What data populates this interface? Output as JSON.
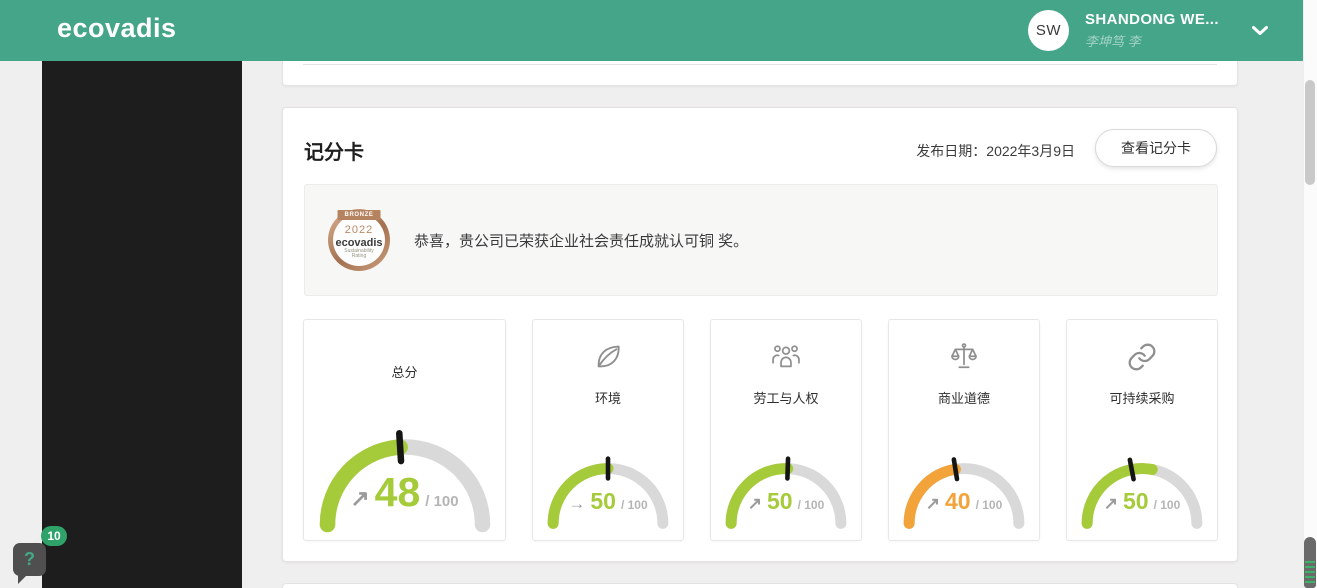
{
  "header": {
    "logo": "ecovadis",
    "user": {
      "initials": "SW",
      "name": "SHANDONG WE...",
      "subtitle": "李坤笃 李"
    }
  },
  "help": {
    "glyph": "?",
    "badge": "10"
  },
  "scorecard": {
    "title": "记分卡",
    "publish_date": "发布日期：2022年3月9日",
    "view_button": "查看记分卡",
    "award": {
      "medal": {
        "tier": "BRONZE",
        "year": "2022",
        "brand": "ecovadis",
        "tagline": "Sustainability Rating"
      },
      "message": "恭喜，贵公司已荣获企业社会责任成就认可铜 奖。"
    },
    "gauges": [
      {
        "label": "总分",
        "icon": null,
        "size": "large",
        "value": "48",
        "suffix": "/ 100",
        "trend_arrow": "↗",
        "color": "#a6cb3a",
        "fill_pct": 48,
        "needle_pct": 48
      },
      {
        "label": "环境",
        "icon": "leaf-icon",
        "size": "small",
        "value": "50",
        "suffix": "/ 100",
        "trend_arrow": "→",
        "color": "#a6cb3a",
        "fill_pct": 50,
        "needle_pct": 50
      },
      {
        "label": "劳工与人权",
        "icon": "people-icon",
        "size": "small",
        "value": "50",
        "suffix": "/ 100",
        "trend_arrow": "↗",
        "color": "#a6cb3a",
        "fill_pct": 51,
        "needle_pct": 51
      },
      {
        "label": "商业道德",
        "icon": "scales-icon",
        "size": "small",
        "value": "40",
        "suffix": "/ 100",
        "trend_arrow": "↗",
        "color": "#f2a33a",
        "fill_pct": 45,
        "needle_pct": 45
      },
      {
        "label": "可持续采购",
        "icon": "link-icon",
        "size": "small",
        "value": "50",
        "suffix": "/ 100",
        "trend_arrow": "↗",
        "color": "#a6cb3a",
        "fill_pct": 56,
        "needle_pct": 44
      }
    ]
  },
  "colors": {
    "header_green": "#44a589",
    "lime": "#a6cb3a",
    "orange": "#f2a33a",
    "gauge_track": "#d9d9d9",
    "needle": "#151515"
  }
}
